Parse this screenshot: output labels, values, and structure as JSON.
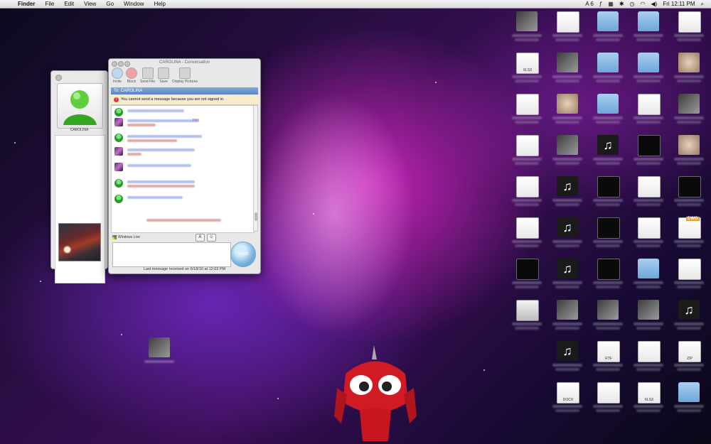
{
  "menubar": {
    "apple": "",
    "items": [
      "Finder",
      "File",
      "Edit",
      "View",
      "Go",
      "Window",
      "Help"
    ],
    "right": {
      "adobe": "A 6",
      "datetime": "Fri 12:11 PM"
    }
  },
  "contact_panel": {
    "name": "CAROLINA"
  },
  "conversation": {
    "title": "CAROLINA - Conversation",
    "toolbar": [
      "Invite",
      "Block",
      "Send File",
      "Save",
      "Display Pictures"
    ],
    "to_label": "To: CAROLINA",
    "notice": "You cannot send a message because you are not signed in.",
    "history_snippet": "PM)",
    "windows_live": "Windows Live",
    "format_label": "A",
    "send_label": "Send",
    "status": "Last message received on 6/18/10 at 12:03 PM"
  },
  "desktop_icons": [
    {
      "type": "img",
      "label": ""
    },
    {
      "type": "doc",
      "label": ""
    },
    {
      "type": "folder",
      "label": ""
    },
    {
      "type": "folder",
      "label": ""
    },
    {
      "type": "doc",
      "label": ""
    },
    {
      "type": "doc",
      "label": "XLSX"
    },
    {
      "type": "img",
      "label": ""
    },
    {
      "type": "folder",
      "label": ""
    },
    {
      "type": "folder",
      "label": ""
    },
    {
      "type": "warm",
      "label": ""
    },
    {
      "type": "doc",
      "label": ""
    },
    {
      "type": "warm",
      "label": ""
    },
    {
      "type": "folder",
      "label": ""
    },
    {
      "type": "doc",
      "label": ""
    },
    {
      "type": "img",
      "label": ""
    },
    {
      "type": "doc",
      "label": ""
    },
    {
      "type": "img",
      "label": ""
    },
    {
      "type": "music",
      "label": ""
    },
    {
      "type": "dark",
      "label": ""
    },
    {
      "type": "warm",
      "label": ""
    },
    {
      "type": "doc",
      "label": ""
    },
    {
      "type": "music",
      "label": ""
    },
    {
      "type": "dark",
      "label": ""
    },
    {
      "type": "doc",
      "label": ""
    },
    {
      "type": "dark",
      "label": ""
    },
    {
      "type": "doc",
      "label": ""
    },
    {
      "type": "music",
      "label": ""
    },
    {
      "type": "dark",
      "label": ""
    },
    {
      "type": "doc",
      "label": ""
    },
    {
      "type": "dwg",
      "label": "DWG"
    },
    {
      "type": "dark",
      "label": ""
    },
    {
      "type": "music",
      "label": ""
    },
    {
      "type": "dark",
      "label": ""
    },
    {
      "type": "folder",
      "label": ""
    },
    {
      "type": "doc",
      "label": ""
    },
    {
      "type": "drive",
      "label": ""
    },
    {
      "type": "img",
      "label": ""
    },
    {
      "type": "img",
      "label": ""
    },
    {
      "type": "img",
      "label": ""
    },
    {
      "type": "music",
      "label": ""
    },
    {
      "type": "music",
      "label": ""
    },
    {
      "type": "doc",
      "label": "RTF"
    },
    {
      "type": "doc",
      "label": ""
    },
    {
      "type": "doc",
      "label": "ZIP"
    },
    {
      "type": "doc",
      "label": "DOCX"
    },
    {
      "type": "doc",
      "label": ""
    },
    {
      "type": "doc",
      "label": "XLSX"
    },
    {
      "type": "folder",
      "label": ""
    }
  ]
}
